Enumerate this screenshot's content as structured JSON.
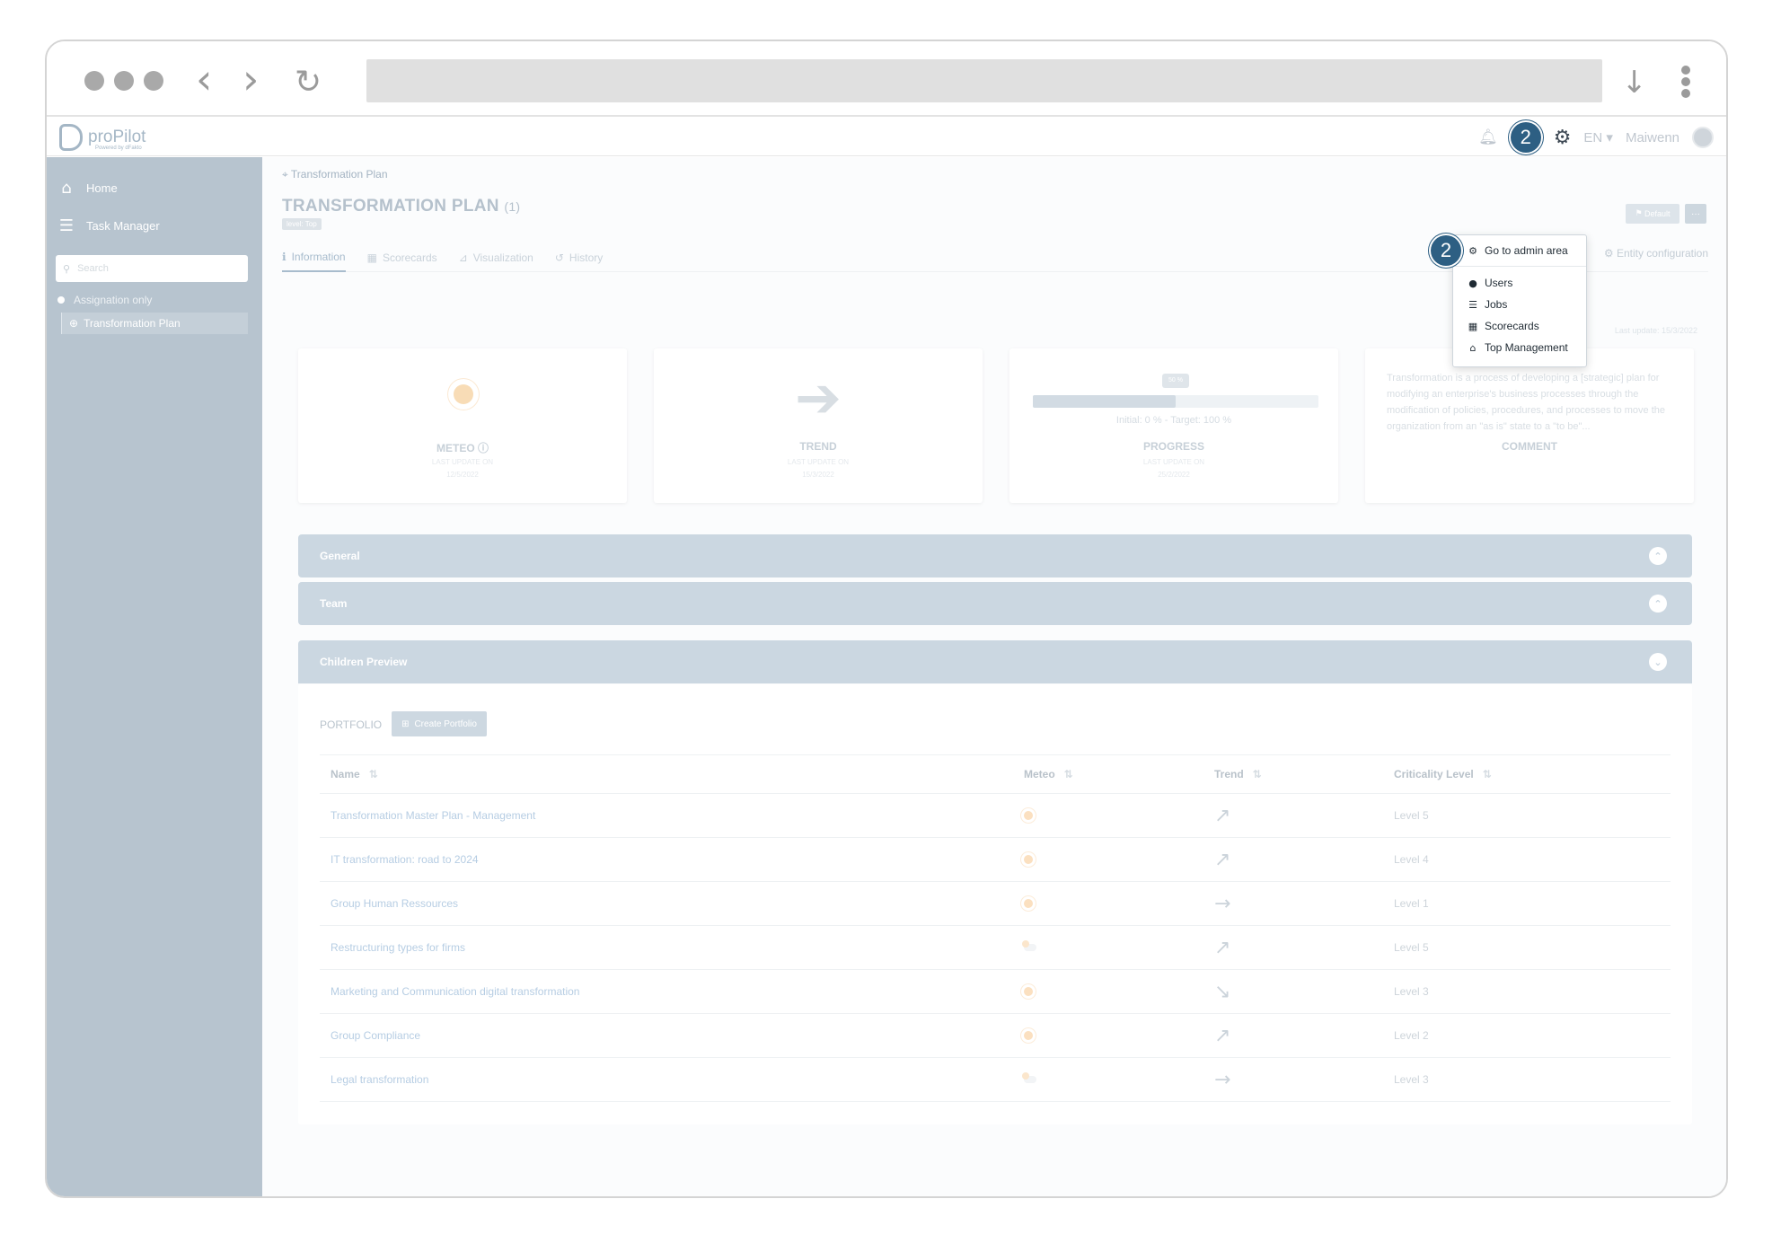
{
  "app": {
    "logo_text": "proPilot",
    "logo_sub": "Powered by dFakto"
  },
  "header": {
    "callout": "2",
    "lang": "EN",
    "user": "Maiwenn"
  },
  "sidebar": {
    "items": [
      {
        "label": "Home",
        "icon": "home-icon"
      },
      {
        "label": "Task Manager",
        "icon": "list-icon"
      }
    ],
    "search_placeholder": "Search",
    "assignation_label": "Assignation only",
    "tree_item": "Transformation Plan"
  },
  "page": {
    "breadcrumb": "Transformation Plan",
    "title": "TRANSFORMATION PLAN",
    "title_count": "(1)",
    "level_tag": "level: Top",
    "default_btn": "Default",
    "more_btn": "···",
    "entity_config": "Entity configuration",
    "last_update": "Last update: 15/3/2022",
    "tabs": [
      "Information",
      "Scorecards",
      "Visualization",
      "History"
    ]
  },
  "cards": {
    "meteo": {
      "caption": "METEO",
      "sub1": "LAST UPDATE ON",
      "sub2": "12/5/2022"
    },
    "trend": {
      "caption": "TREND",
      "sub1": "LAST UPDATE ON",
      "sub2": "15/3/2022"
    },
    "progress": {
      "caption": "PROGRESS",
      "tip": "50 %",
      "value": 50,
      "initial": "Initial: 0 % - Target: 100 %",
      "sub1": "LAST UPDATE ON",
      "sub2": "25/2/2022"
    },
    "comment": {
      "caption": "COMMENT",
      "text": "Transformation is a process of developing a [strategic] plan for modifying an enterprise's business processes through the modification of policies, procedures, and processes to move the organization from an \"as is\" state to a \"to be\"..."
    }
  },
  "accordions": {
    "general": "General",
    "team": "Team",
    "children": "Children Preview"
  },
  "portfolio": {
    "label": "PORTFOLIO",
    "create_btn": "Create Portfolio",
    "columns": [
      "Name",
      "Meteo",
      "Trend",
      "Criticality Level"
    ],
    "rows": [
      {
        "name": "Transformation Master Plan - Management",
        "meteo": "sunny",
        "trend": "↗",
        "level": "Level 5"
      },
      {
        "name": "IT transformation: road to 2024",
        "meteo": "sunny",
        "trend": "↗",
        "level": "Level 4"
      },
      {
        "name": "Group Human Ressources",
        "meteo": "sunny",
        "trend": "→",
        "level": "Level 1"
      },
      {
        "name": "Restructuring types for firms",
        "meteo": "partly-cloudy",
        "trend": "↗",
        "level": "Level 5"
      },
      {
        "name": "Marketing and Communication digital transformation",
        "meteo": "sunny",
        "trend": "↘",
        "level": "Level 3"
      },
      {
        "name": "Group Compliance",
        "meteo": "sunny",
        "trend": "↗",
        "level": "Level 2"
      },
      {
        "name": "Legal transformation",
        "meteo": "partly-cloudy",
        "trend": "→",
        "level": "Level 3"
      }
    ]
  },
  "dropdown": {
    "callout": "2",
    "admin": "Go to admin area",
    "items": [
      {
        "label": "Users",
        "icon": "user-icon"
      },
      {
        "label": "Jobs",
        "icon": "list-icon"
      },
      {
        "label": "Scorecards",
        "icon": "table-icon"
      },
      {
        "label": "Top Management",
        "icon": "home-icon"
      }
    ]
  }
}
